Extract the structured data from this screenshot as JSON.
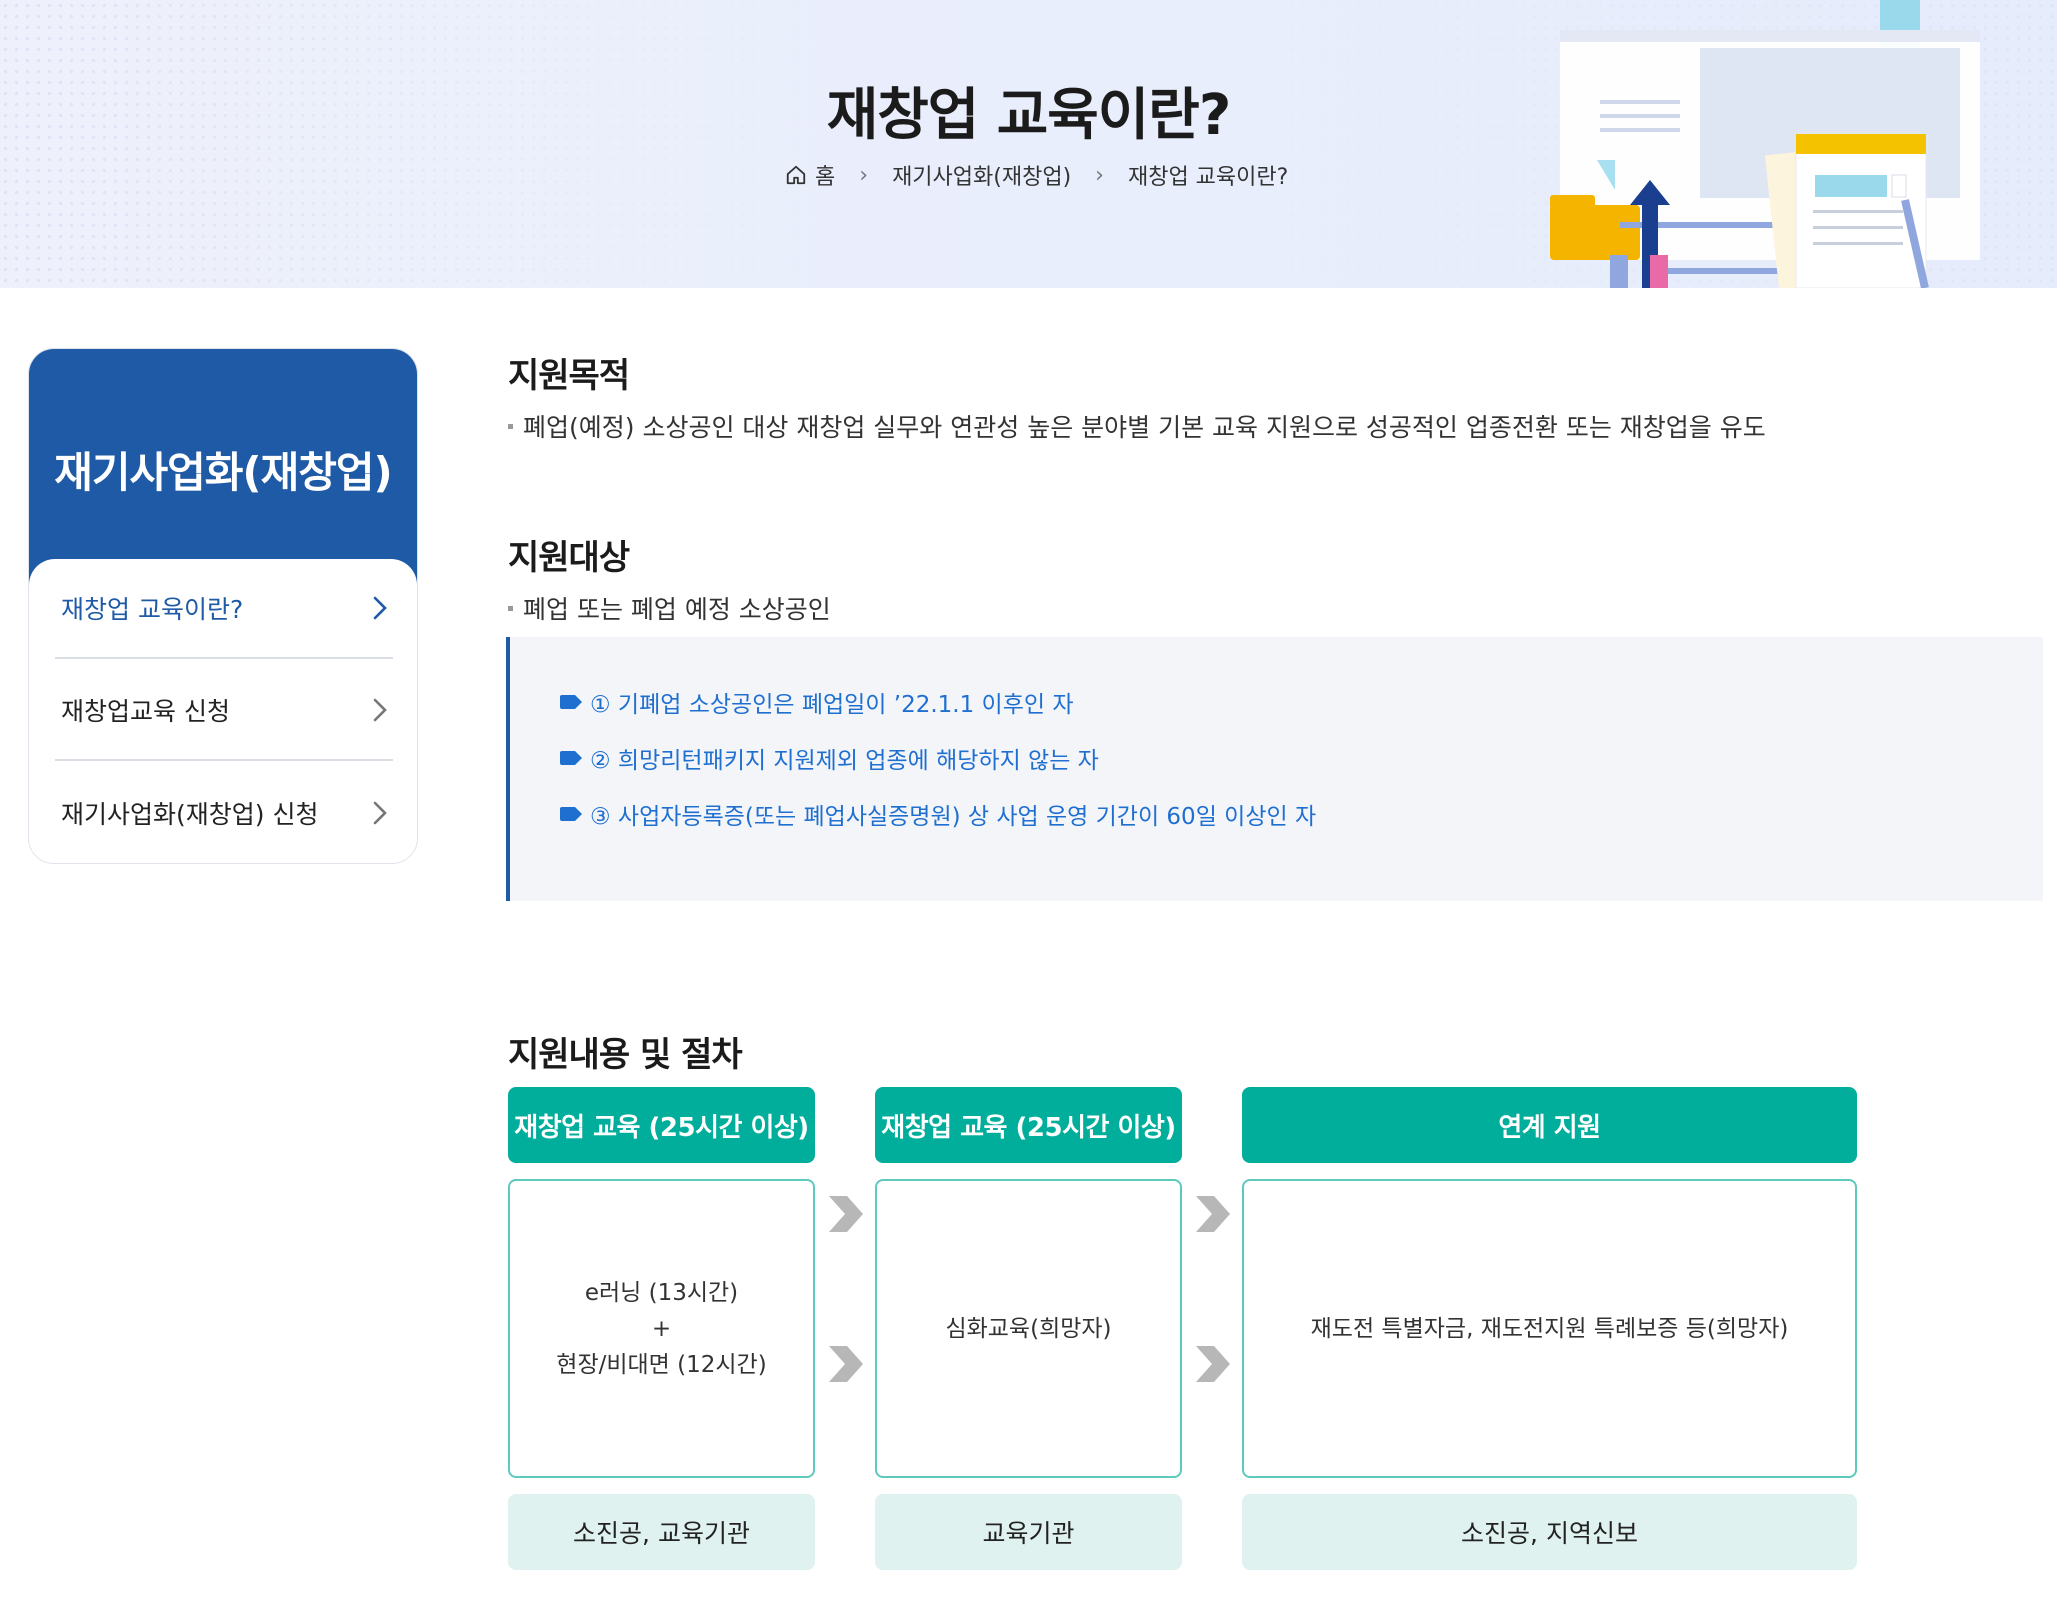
{
  "header": {
    "title": "재창업 교육이란?",
    "breadcrumb": {
      "home_icon": "home-icon",
      "home": "홈",
      "level1": "재기사업화(재창업)",
      "level2": "재창업 교육이란?"
    }
  },
  "sidebar": {
    "title": "재기사업화(재창업)",
    "items": [
      {
        "label": "재창업 교육이란?",
        "active": true
      },
      {
        "label": "재창업교육 신청",
        "active": false
      },
      {
        "label": "재기사업화(재창업) 신청",
        "active": false
      }
    ]
  },
  "sections": {
    "purpose": {
      "heading": "지원목적",
      "text": "폐업(예정) 소상공인 대상 재창업 실무와 연관성 높은 분야별 기본 교육 지원으로 성공적인 업종전환 또는 재창업을 유도"
    },
    "target": {
      "heading": "지원대상",
      "text": "폐업 또는 폐업 예정 소상공인",
      "conditions": [
        "① 기폐업 소상공인은 폐업일이 ’22.1.1 이후인 자",
        "② 희망리턴패키지 지원제외 업종에 해당하지 않는 자",
        "③ 사업자등록증(또는 폐업사실증명원) 상 사업 운영 기간이 60일 이상인 자"
      ]
    },
    "process": {
      "heading": "지원내용 및 절차",
      "steps": [
        {
          "title": "재창업 교육 (25시간 이상)",
          "body": [
            "e러닝 (13시간)",
            "+",
            "현장/비대면 (12시간)"
          ],
          "org": "소진공, 교육기관"
        },
        {
          "title": "재창업 교육 (25시간 이상)",
          "body": [
            "심화교육(희망자)"
          ],
          "org": "교육기관"
        },
        {
          "title": "연계 지원",
          "body": [
            "재도전 특별자금, 재도전지원 특례보증 등(희망자)"
          ],
          "org": "소진공, 지역신보"
        }
      ]
    }
  },
  "colors": {
    "primary_blue": "#1f5aa6",
    "teal": "#00ae9b",
    "teal_light": "#dff2ef",
    "info_blue": "#1f6fd1"
  }
}
